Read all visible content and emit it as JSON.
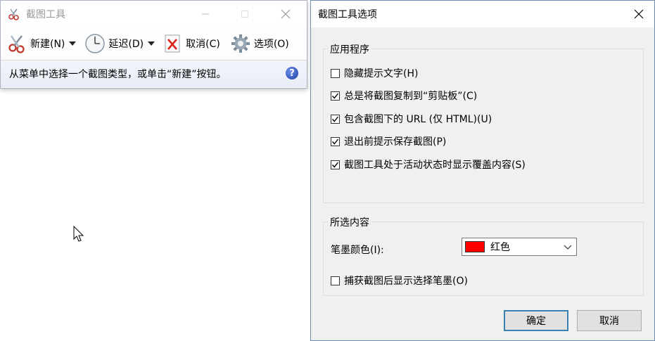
{
  "snip": {
    "title": "截图工具",
    "toolbar": {
      "new_label": "新建(N)",
      "delay_label": "延迟(D)",
      "cancel_label": "取消(C)",
      "options_label": "选项(O)"
    },
    "status": "从菜单中选择一个截图类型，或单击“新建”按钮。",
    "help": "?"
  },
  "dialog": {
    "title": "截图工具选项",
    "app_group": {
      "label": "应用程序",
      "options": [
        {
          "label": "隐藏提示文字(H)",
          "checked": false
        },
        {
          "label": "总是将截图复制到“剪贴板”(C)",
          "checked": true
        },
        {
          "label": "包含截图下的 URL (仅 HTML)(U)",
          "checked": true
        },
        {
          "label": "退出前提示保存截图(P)",
          "checked": true
        },
        {
          "label": "截图工具处于活动状态时显示覆盖内容(S)",
          "checked": true
        }
      ]
    },
    "selection_group": {
      "label": "所选内容",
      "ink_color_label": "笔墨颜色(I):",
      "ink_color_value": "红色",
      "ink_color_hex": "#ff0000",
      "show_ink_label": "捕获截图后显示选择笔墨(O)",
      "show_ink_checked": false
    },
    "ok_label": "确定",
    "cancel_label": "取消"
  }
}
